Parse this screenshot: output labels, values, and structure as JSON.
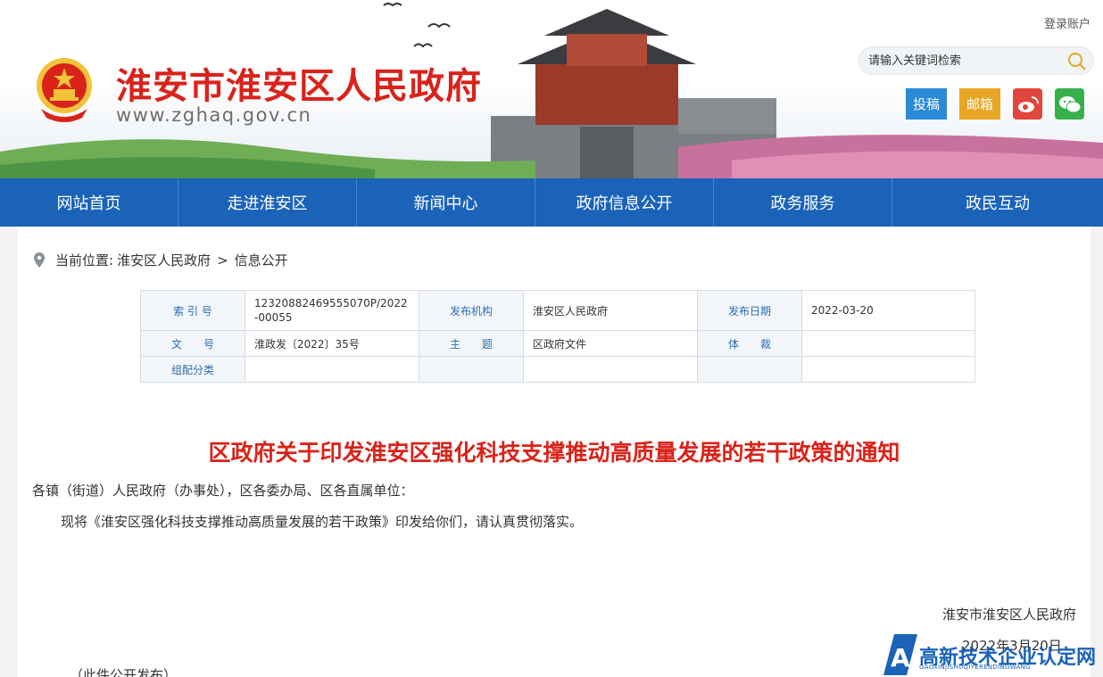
{
  "header": {
    "site_title": "淮安市淮安区人民政府",
    "site_url": "www.zghaq.gov.cn",
    "login_label": "登录账户",
    "search_placeholder": "请输入关键词检索",
    "buttons": {
      "tougao": "投稿",
      "youxiang": "邮箱"
    }
  },
  "nav": {
    "items": [
      "网站首页",
      "走进淮安区",
      "新闻中心",
      "政府信息公开",
      "政务服务",
      "政民互动"
    ]
  },
  "breadcrumb": {
    "prefix": "当前位置:",
    "items": [
      "淮安区人民政府",
      "信息公开"
    ],
    "separator": ">"
  },
  "meta_table": {
    "index_label": "索 引 号",
    "index_value": "12320882469555070P/2022-00055",
    "publisher_label": "发布机构",
    "publisher_value": "淮安区人民政府",
    "pubdate_label": "发布日期",
    "pubdate_value": "2022-03-20",
    "docno_label": "文　　号",
    "docno_value": "淮政发〔2022〕35号",
    "topic_label": "主　　题",
    "topic_value": "区政府文件",
    "genre_label": "体　　裁",
    "genre_value": "",
    "category_label": "组配分类",
    "category_value": ""
  },
  "document": {
    "title": "区政府关于印发淮安区强化科技支撑推动高质量发展的若干政策的通知",
    "salutation": "各镇（街道）人民政府（办事处），区各委办局、区各直属单位：",
    "body": "现将《淮安区强化科技支撑推动高质量发展的若干政策》印发给你们，请认真贯彻落实。",
    "signature": "淮安市淮安区人民政府",
    "date": "2022年3月20日",
    "note": "（此件公开发布）"
  },
  "watermark": {
    "text": "高新技术企业认定网",
    "sub": "GAOXINJISHUQIYERENDINGWANG"
  },
  "colors": {
    "nav_bg": "#1a63b9",
    "title_red": "#d9231a",
    "tougao": "#2a8ad5",
    "youxiang": "#e7a624",
    "weibo": "#e2453c",
    "weixin": "#37b04b"
  }
}
